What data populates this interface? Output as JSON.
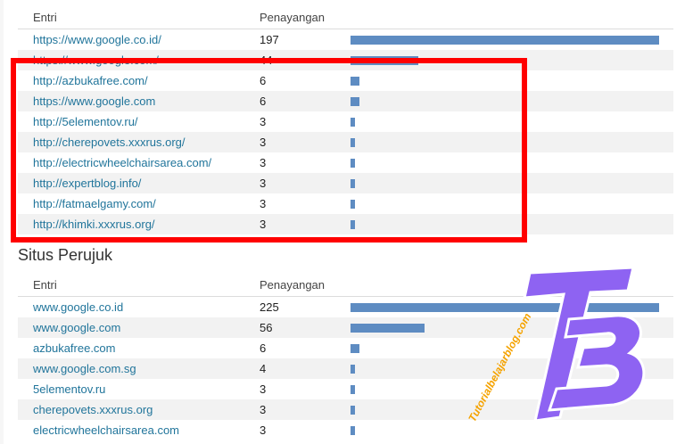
{
  "table1": {
    "header": {
      "entry": "Entri",
      "views": "Penayangan"
    },
    "rows": [
      {
        "entry": "https://www.google.co.id/",
        "views": "197",
        "fraction": 1.0
      },
      {
        "entry": "https://www.google.com/",
        "views": "44",
        "fraction": 0.22
      },
      {
        "entry": "http://azbukafree.com/",
        "views": "6",
        "fraction": 0.03
      },
      {
        "entry": "https://www.google.com",
        "views": "6",
        "fraction": 0.03
      },
      {
        "entry": "http://5elementov.ru/",
        "views": "3",
        "fraction": 0.015
      },
      {
        "entry": "http://cherepovets.xxxrus.org/",
        "views": "3",
        "fraction": 0.015
      },
      {
        "entry": "http://electricwheelchairsarea.com/",
        "views": "3",
        "fraction": 0.015
      },
      {
        "entry": "http://expertblog.info/",
        "views": "3",
        "fraction": 0.015
      },
      {
        "entry": "http://fatmaelgamy.com/",
        "views": "3",
        "fraction": 0.015
      },
      {
        "entry": "http://khimki.xxxrus.org/",
        "views": "3",
        "fraction": 0.015
      }
    ]
  },
  "section2": {
    "title": "Situs Perujuk"
  },
  "table2": {
    "header": {
      "entry": "Entri",
      "views": "Penayangan"
    },
    "rows": [
      {
        "entry": "www.google.co.id",
        "views": "225",
        "fraction": 1.0
      },
      {
        "entry": "www.google.com",
        "views": "56",
        "fraction": 0.24
      },
      {
        "entry": "azbukafree.com",
        "views": "6",
        "fraction": 0.03
      },
      {
        "entry": "www.google.com.sg",
        "views": "4",
        "fraction": 0.015
      },
      {
        "entry": "5elementov.ru",
        "views": "3",
        "fraction": 0.015
      },
      {
        "entry": "cherepovets.xxxrus.org",
        "views": "3",
        "fraction": 0.015
      },
      {
        "entry": "electricwheelchairsarea.com",
        "views": "3",
        "fraction": 0.015
      }
    ]
  },
  "logo": {
    "letters": "TB",
    "watermark": "Tutorialbelajarblog.com"
  },
  "colors": {
    "link": "#21759b",
    "bar": "#5e8cc2",
    "highlight": "#ff0000",
    "logo": "#8e63f2"
  }
}
